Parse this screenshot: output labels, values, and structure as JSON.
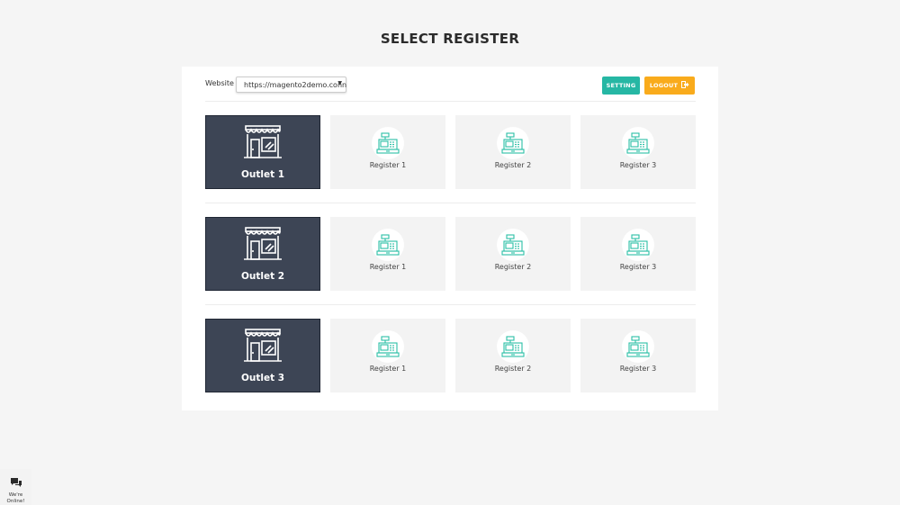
{
  "page": {
    "title": "SELECT REGISTER"
  },
  "toolbar": {
    "website_label": "Website",
    "website_value": "https://magento2demo.conn",
    "setting_label": "SETTING",
    "logout_label": "LOGOUT"
  },
  "outlets": [
    {
      "name": "Outlet 1",
      "registers": [
        "Register 1",
        "Register 2",
        "Register 3"
      ]
    },
    {
      "name": "Outlet 2",
      "registers": [
        "Register 1",
        "Register 2",
        "Register 3"
      ]
    },
    {
      "name": "Outlet 3",
      "registers": [
        "Register 1",
        "Register 2",
        "Register 3"
      ]
    }
  ],
  "chat": {
    "line1": "We're",
    "line2": "Online!"
  },
  "icons": {
    "outlet": "storefront-icon",
    "register": "cash-register-icon",
    "logout": "sign-out-icon",
    "chat": "chat-bubbles-icon",
    "caret": "caret-down-icon"
  },
  "colors": {
    "setting_button": "#26b7a4",
    "logout_button": "#f9ab1c",
    "outlet_card": "#3d4555",
    "register_icon": "#2bbfa6"
  }
}
